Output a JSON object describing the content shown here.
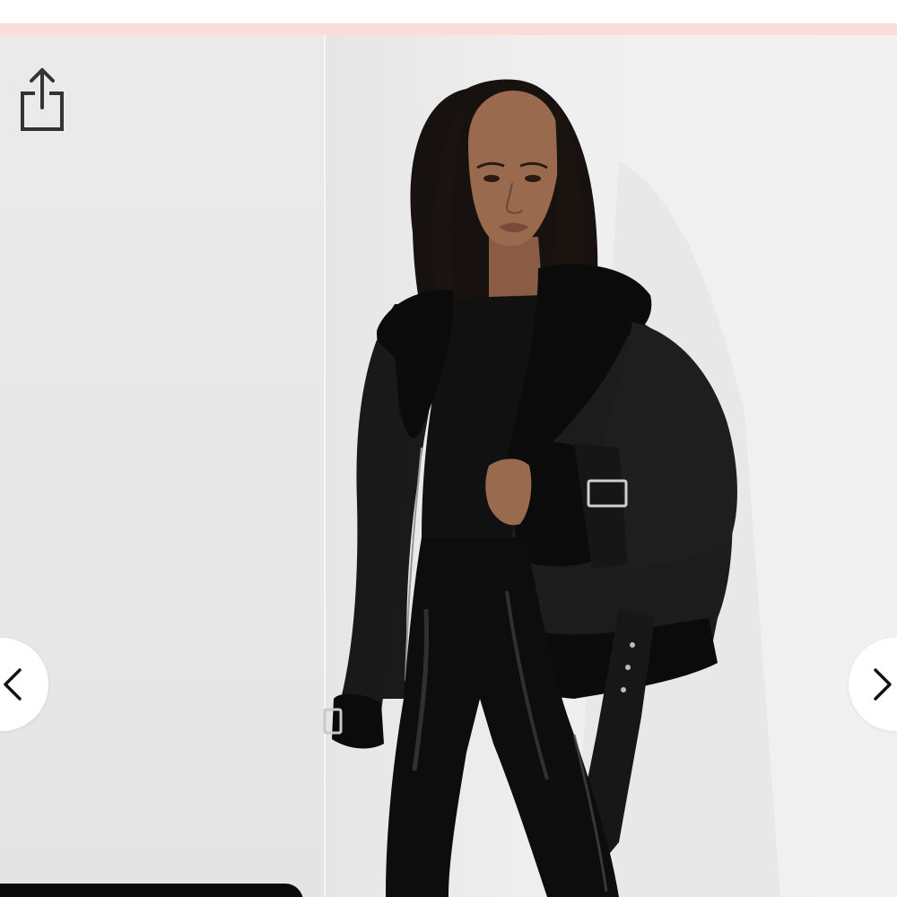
{
  "header": {
    "promo_bar_color": "#fbdcd8"
  },
  "gallery": {
    "image_description_icon": "model-photo",
    "controls": {
      "share_icon": "share-icon",
      "prev_icon": "chevron-left-icon",
      "next_icon": "chevron-right-icon"
    },
    "colors": {
      "background_left": "#e8e8e8",
      "background_right": "#efefef",
      "jacket": "#151515",
      "fur": "#0b0b0b",
      "skin": "#9a6a4f",
      "hair": "#171210"
    }
  }
}
